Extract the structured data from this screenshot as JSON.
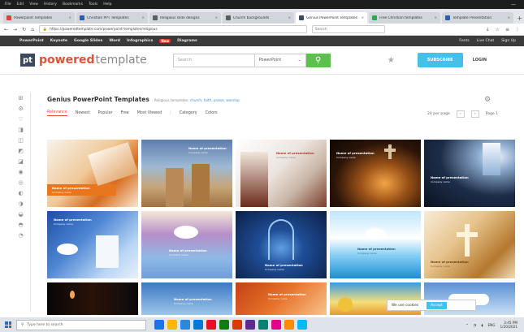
{
  "browser": {
    "menu": [
      "File",
      "Edit",
      "View",
      "History",
      "Bookmarks",
      "Tools",
      "Help"
    ],
    "tabs": [
      {
        "label": "Powerpoint Templates",
        "color": "#d9453a"
      },
      {
        "label": "Christian PPT Templates",
        "color": "#2b5fae"
      },
      {
        "label": "Religious slide designs",
        "color": "#5c5c5c"
      },
      {
        "label": "Church backgrounds",
        "color": "#5c5c5c"
      },
      {
        "label": "Genius PowerPoint Templates",
        "color": "#3b4a5e"
      },
      {
        "label": "Free Christian templates",
        "color": "#2fa84f"
      },
      {
        "label": "Template Presentation",
        "color": "#2b5fae"
      }
    ],
    "new_tab": "+",
    "url": "https://poweredtemplate.com/powerpoint-templates/religious",
    "search_placeholder": "Search",
    "nav_icons": [
      "←",
      "→",
      "↻",
      "⌂"
    ],
    "toolbar_icons": [
      "↓",
      "☆",
      "≡",
      "⋮"
    ]
  },
  "site_nav": {
    "items": [
      "PowerPoint",
      "Keynote",
      "Google Slides",
      "Word",
      "Infographics",
      "Diagrams"
    ],
    "hot": "New",
    "right": [
      "Fonts",
      "Live Chat",
      "Sign Up"
    ]
  },
  "header": {
    "logo_mark": "pt",
    "logo_text_1": "powered",
    "logo_text_2": "template",
    "search_placeholder": "Search",
    "search_category": "PowerPoint",
    "search_button": "⚲",
    "cta": "SUBSCRIBE",
    "login": "LOGIN"
  },
  "sidebar": {
    "icons": [
      "⊞",
      "⚙",
      "♡",
      "◨",
      "◫",
      "◩",
      "◪",
      "◉",
      "◎",
      "◐",
      "◑",
      "◒",
      "◓",
      "◔"
    ]
  },
  "content": {
    "title": "Genius PowerPoint Templates",
    "subtitle": "Religious templates: ",
    "subtitle_link": "church, faith, praise, worship",
    "filters": [
      "Relevance",
      "Newest",
      "Popular",
      "Free",
      "Most Viewed",
      "Category",
      "Colors"
    ],
    "pager": {
      "per_page": "24 per page",
      "prev": "‹",
      "next": "›",
      "page": "Page 1"
    }
  },
  "cards": [
    {
      "title": "Name of presentation",
      "subtitle": "Company name"
    },
    {
      "title": "Name of presentation",
      "subtitle": "Company name"
    },
    {
      "title": "Name of presentation",
      "subtitle": "Company name"
    },
    {
      "title": "Name of presentation",
      "subtitle": "Company name"
    },
    {
      "title": "Name of presentation",
      "subtitle": "Company name"
    },
    {
      "title": "Name of presentation",
      "subtitle": "Company name"
    },
    {
      "title": "Name of presentation",
      "subtitle": "Company name"
    },
    {
      "title": "Name of presentation",
      "subtitle": "Company name"
    },
    {
      "title": "Name of presentation",
      "subtitle": "Company name"
    },
    {
      "title": "Name of presentation",
      "subtitle": "Company name"
    },
    {
      "title": "",
      "subtitle": ""
    },
    {
      "title": "Name of presentation",
      "subtitle": "Company name"
    },
    {
      "title": "Name of presentation",
      "subtitle": "Company name"
    },
    {
      "title": "",
      "subtitle": ""
    },
    {
      "title": "",
      "subtitle": ""
    }
  ],
  "cookie": {
    "text": "We use cookies",
    "button": "Accept"
  },
  "taskbar": {
    "search_placeholder": "Type here to search",
    "apps": [
      "#1a73e8",
      "#ffb900",
      "#2b88d8",
      "#0078d7",
      "#e81123",
      "#107c10",
      "#d83b01",
      "#5c2d91",
      "#008272",
      "#e3008c",
      "#ff8c00",
      "#00bcf2"
    ],
    "tray": "ENG",
    "time": "3:45 PM",
    "date": "1/20/2021"
  }
}
